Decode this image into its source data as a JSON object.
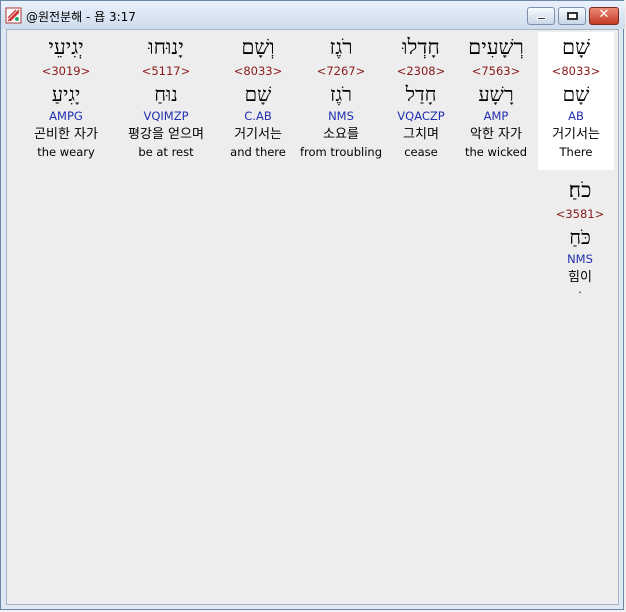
{
  "window": {
    "title": "@원전분해 - 욥 3:17",
    "minimize": "–",
    "maximize": "□",
    "close": "✕"
  },
  "words": [
    {
      "surface": "שָׁם",
      "strong": "<8033>",
      "lemma": "שָׁם",
      "parse": "AB",
      "korean": "거기서는",
      "english": "There"
    },
    {
      "surface": "רְשָׁעִים",
      "strong": "<7563>",
      "lemma": "רָשָׁע",
      "parse": "AMP",
      "korean": "악한 자가",
      "english": "the wicked"
    },
    {
      "surface": "חָדְלוּ",
      "strong": "<2308>",
      "lemma": "חָדַל",
      "parse": "VQACZP",
      "korean": "그치며",
      "english": "cease"
    },
    {
      "surface": "רֹגֶז",
      "strong": "<7267>",
      "lemma": "רֹגֶז",
      "parse": "NMS",
      "korean": "소요를",
      "english": "from troubling"
    },
    {
      "surface": "וְשָׁם",
      "strong": "<8033>",
      "lemma": "שָׁם",
      "parse": "C.AB",
      "korean": "거기서는",
      "english": "and there"
    },
    {
      "surface": "יָנוּחוּ",
      "strong": "<5117>",
      "lemma": "נוּחַ",
      "parse": "VQIMZP",
      "korean": "평강을 얻으며",
      "english": "be at rest"
    },
    {
      "surface": "יְגִיעֵי",
      "strong": "<3019>",
      "lemma": "יָגִיעַ",
      "parse": "AMPG",
      "korean": "곤비한 자가",
      "english": "the weary"
    },
    {
      "surface": "כֹחַ׃",
      "strong": "<3581>",
      "lemma": "כֹּחַ",
      "parse": "NMS",
      "korean": "힘이",
      "english": "."
    }
  ]
}
